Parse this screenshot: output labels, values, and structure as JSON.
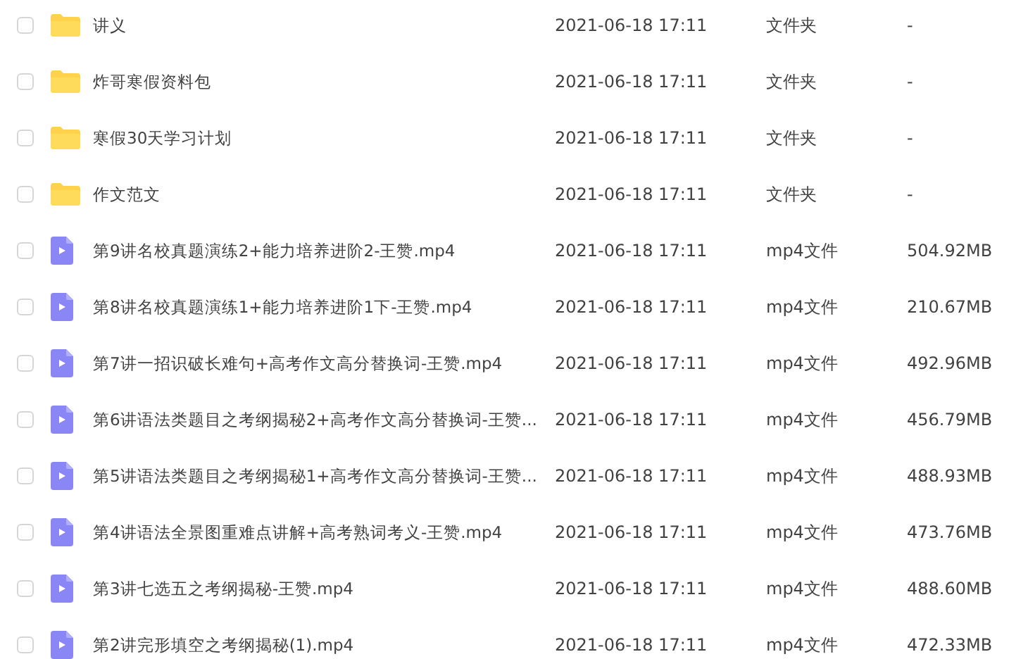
{
  "files": [
    {
      "kind": "folder",
      "checked": false,
      "name": "讲义",
      "modified": "2021-06-18 17:11",
      "type": "文件夹",
      "size": "-"
    },
    {
      "kind": "folder",
      "checked": false,
      "name": "炸哥寒假资料包",
      "modified": "2021-06-18 17:11",
      "type": "文件夹",
      "size": "-"
    },
    {
      "kind": "folder",
      "checked": false,
      "name": "寒假30天学习计划",
      "modified": "2021-06-18 17:11",
      "type": "文件夹",
      "size": "-"
    },
    {
      "kind": "folder",
      "checked": false,
      "name": "作文范文",
      "modified": "2021-06-18 17:11",
      "type": "文件夹",
      "size": "-"
    },
    {
      "kind": "video",
      "checked": false,
      "name": "第9讲名校真题演练2+能力培养进阶2-王赞.mp4",
      "modified": "2021-06-18 17:11",
      "type": "mp4文件",
      "size": "504.92MB"
    },
    {
      "kind": "video",
      "checked": false,
      "name": "第8讲名校真题演练1+能力培养进阶1下-王赞.mp4",
      "modified": "2021-06-18 17:11",
      "type": "mp4文件",
      "size": "210.67MB"
    },
    {
      "kind": "video",
      "checked": false,
      "name": "第7讲一招识破长难句+高考作文高分替换词-王赞.mp4",
      "modified": "2021-06-18 17:11",
      "type": "mp4文件",
      "size": "492.96MB"
    },
    {
      "kind": "video",
      "checked": false,
      "name": "第6讲语法类题目之考纲揭秘2+高考作文高分替换词-王赞...",
      "modified": "2021-06-18 17:11",
      "type": "mp4文件",
      "size": "456.79MB"
    },
    {
      "kind": "video",
      "checked": false,
      "name": "第5讲语法类题目之考纲揭秘1+高考作文高分替换词-王赞...",
      "modified": "2021-06-18 17:11",
      "type": "mp4文件",
      "size": "488.93MB"
    },
    {
      "kind": "video",
      "checked": false,
      "name": "第4讲语法全景图重难点讲解+高考熟词考义-王赞.mp4",
      "modified": "2021-06-18 17:11",
      "type": "mp4文件",
      "size": "473.76MB"
    },
    {
      "kind": "video",
      "checked": false,
      "name": "第3讲七选五之考纲揭秘-王赞.mp4",
      "modified": "2021-06-18 17:11",
      "type": "mp4文件",
      "size": "488.60MB"
    },
    {
      "kind": "video",
      "checked": false,
      "name": "第2讲完形填空之考纲揭秘(1).mp4",
      "modified": "2021-06-18 17:11",
      "type": "mp4文件",
      "size": "472.33MB"
    }
  ]
}
